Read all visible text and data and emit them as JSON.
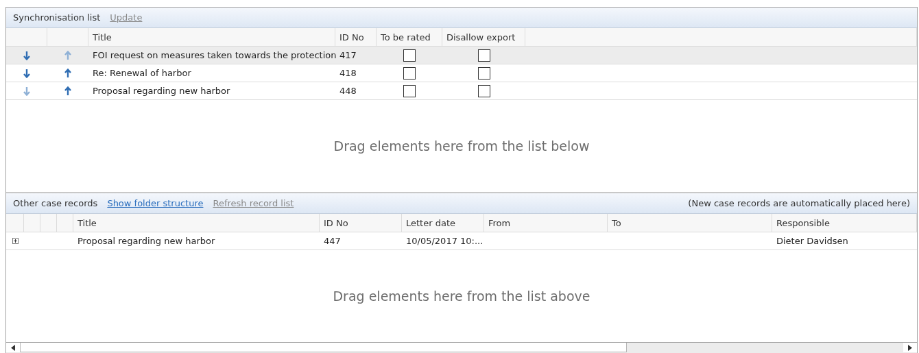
{
  "sync_list": {
    "title": "Synchronisation list",
    "update_link": {
      "label": "Update",
      "disabled": true
    },
    "columns": [
      "Title",
      "ID No",
      "To be rated",
      "Disallow export"
    ],
    "rows": [
      {
        "down_enabled": true,
        "up_enabled": false,
        "title": "FOI request on measures taken towards the protection",
        "id": "417",
        "to_be_rated": false,
        "disallow_export": false,
        "selected": true
      },
      {
        "down_enabled": true,
        "up_enabled": true,
        "title": "Re: Renewal of harbor",
        "id": "418",
        "to_be_rated": false,
        "disallow_export": false,
        "selected": false
      },
      {
        "down_enabled": false,
        "up_enabled": true,
        "title": "Proposal regarding new harbor",
        "id": "448",
        "to_be_rated": false,
        "disallow_export": false,
        "selected": false
      }
    ],
    "drop_hint": "Drag elements here from the list below"
  },
  "other_records": {
    "title": "Other case records",
    "links": [
      {
        "label": "Show folder structure",
        "disabled": false
      },
      {
        "label": "Refresh record list",
        "disabled": true
      }
    ],
    "note": "(New case records are automatically placed here)",
    "columns": [
      "Title",
      "ID No",
      "Letter date",
      "From",
      "To",
      "Responsible"
    ],
    "rows": [
      {
        "expanded": false,
        "title": "Proposal regarding new harbor",
        "id": "447",
        "letter_date": "10/05/2017 10:...",
        "from": "",
        "to": "",
        "responsible": "Dieter Davidsen"
      }
    ],
    "drop_hint": "Drag elements here from the list above"
  }
}
